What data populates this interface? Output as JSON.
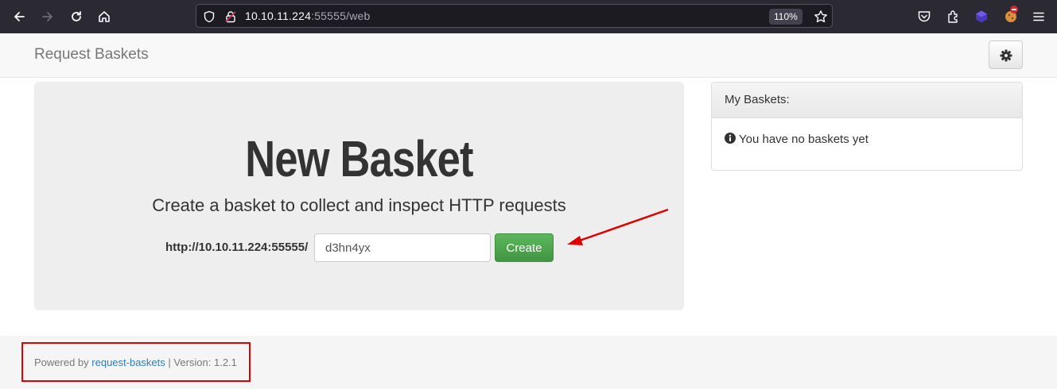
{
  "browser": {
    "url_host": "10.10.11.224",
    "url_rest": ":55555/web",
    "zoom": "110%"
  },
  "navbar": {
    "brand": "Request Baskets"
  },
  "jumbotron": {
    "title": "New Basket",
    "subtitle": "Create a basket to collect and inspect HTTP requests",
    "url_prefix": "http://10.10.11.224:55555/",
    "basket_name": "d3hn4yx",
    "create_label": "Create"
  },
  "baskets_panel": {
    "heading": "My Baskets:",
    "empty_message": "You have no baskets yet"
  },
  "footer": {
    "powered_by": "Powered by",
    "link_text": "request-baskets",
    "version": "| Version: 1.2.1"
  },
  "colors": {
    "create_button": "#4cae4c",
    "annotation_red": "#e00000",
    "link": "#337ab7"
  }
}
